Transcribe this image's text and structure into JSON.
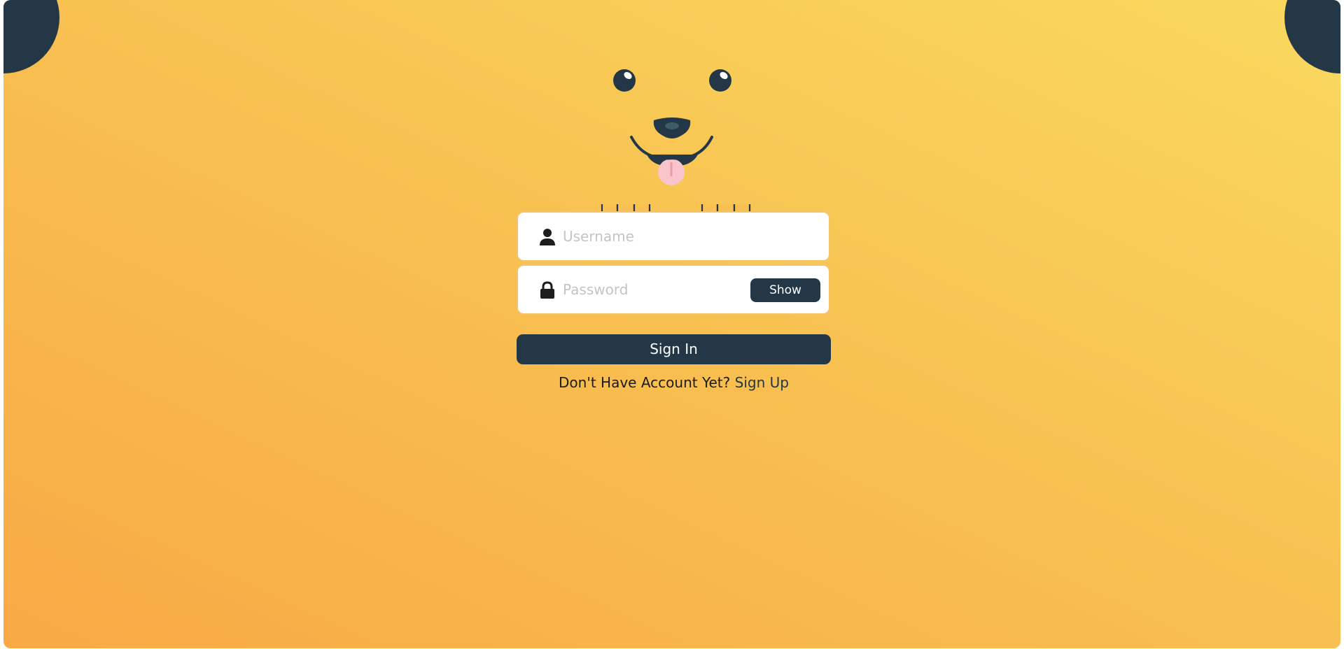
{
  "login": {
    "username_placeholder": "Username",
    "password_placeholder": "Password",
    "show_label": "Show",
    "signin_label": "Sign In",
    "signup_prompt": "Don't Have Account Yet?",
    "signup_link": "Sign Up"
  },
  "icons": {
    "username": "user-icon",
    "password": "lock-icon"
  },
  "colors": {
    "background_start": "#f8a945",
    "background_end": "#f9d95f",
    "dark": "#233746",
    "tongue": "#f9c4cc",
    "field_bg": "#ffffff",
    "placeholder": "#c4c4c4"
  }
}
